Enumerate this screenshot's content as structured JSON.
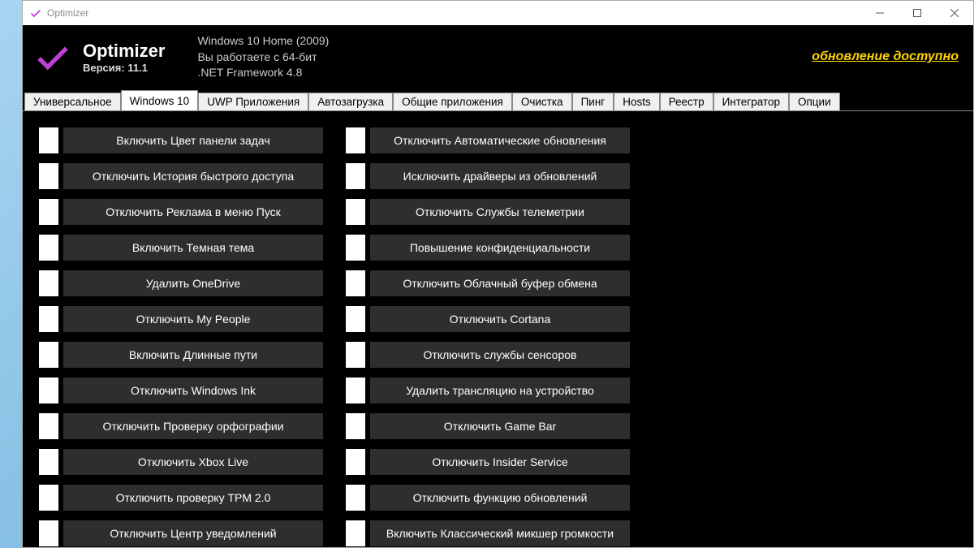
{
  "titlebar": {
    "title": "Optimizer"
  },
  "header": {
    "app_name": "Optimizer",
    "version": "Версия: 11.1",
    "os": "Windows 10 Home (2009)",
    "arch": "Вы работаете с 64-бит",
    "net": ".NET Framework 4.8",
    "update": "обновление доступно"
  },
  "tabs": [
    "Универсальное",
    "Windows 10",
    "UWP Приложения",
    "Автозагрузка",
    "Общие приложения",
    "Очистка",
    "Пинг",
    "Hosts",
    "Реестр",
    "Интегратор",
    "Опции"
  ],
  "active_tab_index": 1,
  "col1": [
    "Включить Цвет панели задач",
    "Отключить История быстрого доступа",
    "Отключить Реклама в меню Пуск",
    "Включить Темная тема",
    "Удалить OneDrive",
    "Отключить My People",
    "Включить Длинные пути",
    "Отключить Windows Ink",
    "Отключить Проверку орфографии",
    "Отключить Xbox Live",
    "Отключить проверку TPM 2.0",
    "Отключить Центр уведомлений"
  ],
  "col2": [
    "Отключить Автоматические обновления",
    "Исключить драйверы из обновлений",
    "Отключить Службы телеметрии",
    "Повышение конфиденциальности",
    "Отключить Облачный буфер обмена",
    "Отключить Cortana",
    "Отключить службы сенсоров",
    "Удалить трансляцию на устройство",
    "Отключить Game Bar",
    "Отключить Insider Service",
    "Отключить функцию обновлений",
    "Включить Классический микшер громкости"
  ]
}
